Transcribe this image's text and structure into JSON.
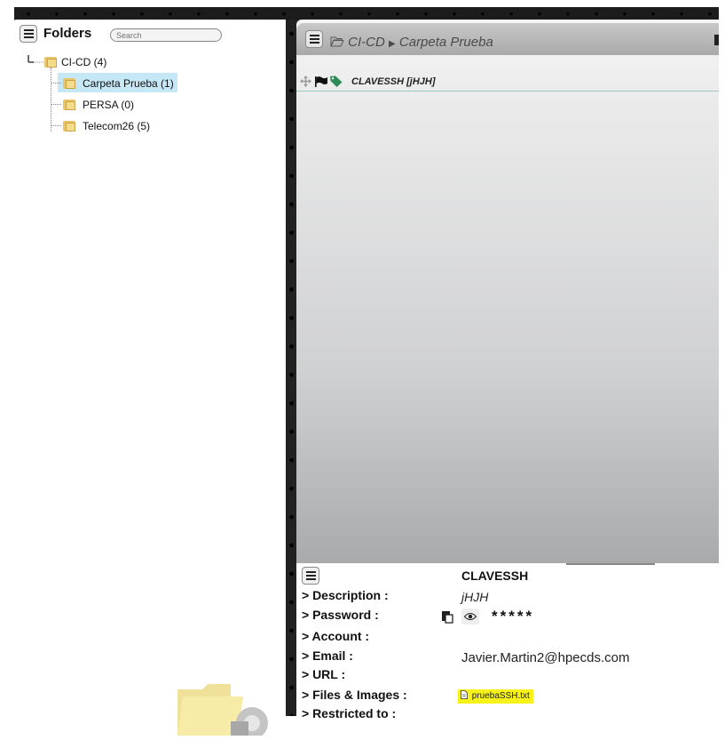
{
  "folders_panel": {
    "title": "Folders",
    "search_placeholder": "Search",
    "tree": {
      "root": {
        "label": "CI-CD (4)"
      },
      "children": [
        {
          "label": "Carpeta Prueba (1)",
          "selected": true
        },
        {
          "label": "PERSA (0)",
          "selected": false
        },
        {
          "label": "Telecom26 (5)",
          "selected": false
        }
      ]
    }
  },
  "items_panel": {
    "breadcrumb": [
      "CI-CD",
      "Carpeta Prueba"
    ],
    "items": [
      {
        "label": "CLAVESSH [jHJH]"
      }
    ]
  },
  "details": {
    "title": "CLAVESSH",
    "fields": {
      "description": {
        "label": "> Description :",
        "value": "jHJH"
      },
      "password": {
        "label": "> Password :",
        "value": "*****"
      },
      "account": {
        "label": "> Account :",
        "value": ""
      },
      "email": {
        "label": "> Email :",
        "value": "Javier.Martin2@hpecds.com"
      },
      "url": {
        "label": "> URL :",
        "value": ""
      },
      "files": {
        "label": "> Files & Images :",
        "value": "pruebaSSH.txt"
      },
      "restricted": {
        "label": "> Restricted to :",
        "value": ""
      }
    }
  },
  "colors": {
    "selected_bg": "#c6e7f6",
    "file_highlight": "#f6f21a",
    "tag_icon": "#2e8b57"
  }
}
